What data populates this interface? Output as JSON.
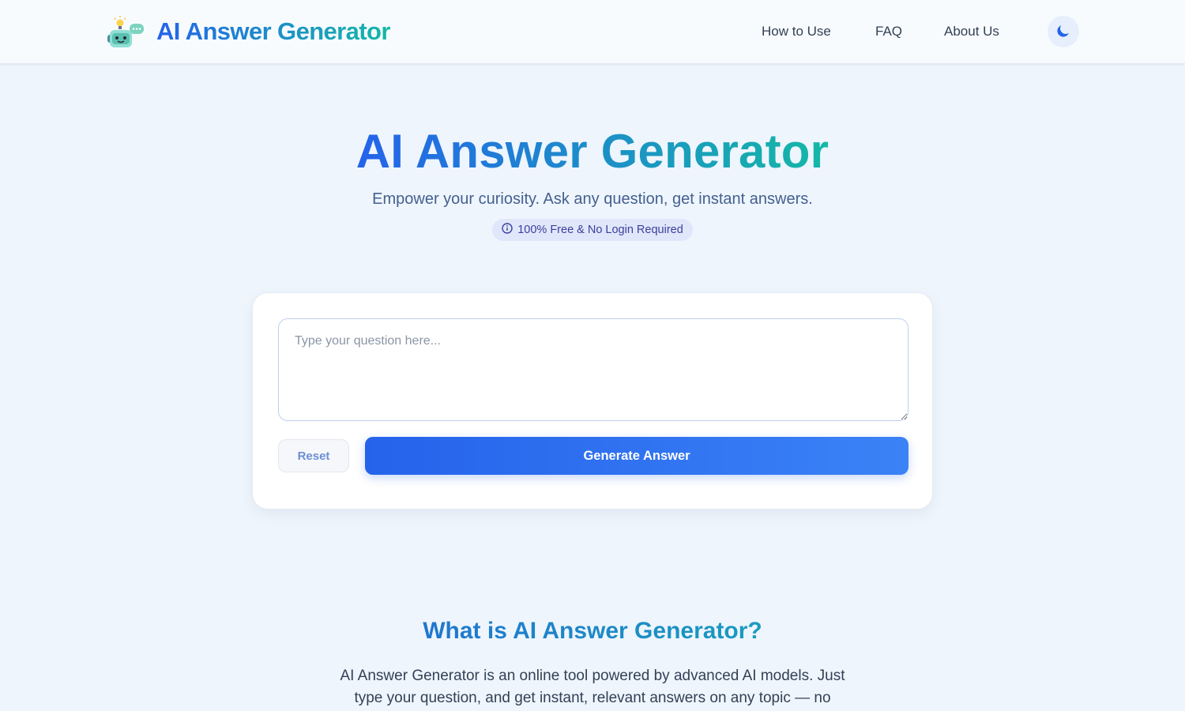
{
  "header": {
    "brand": "AI Answer Generator",
    "nav": {
      "how_to_use": "How to Use",
      "faq": "FAQ",
      "about_us": "About Us"
    },
    "theme_toggle_icon": "moon-icon",
    "logo_icon": "robot-chat-icon"
  },
  "hero": {
    "title": "AI Answer Generator",
    "subtitle": "Empower your curiosity. Ask any question, get instant answers.",
    "badge": {
      "icon": "info-icon",
      "text": "100% Free & No Login Required"
    }
  },
  "form": {
    "question_placeholder": "Type your question here...",
    "question_value": "",
    "reset_label": "Reset",
    "generate_label": "Generate Answer"
  },
  "about": {
    "title": "What is AI Answer Generator?",
    "text": "AI Answer Generator is an online tool powered by advanced AI models. Just type your question, and get instant, relevant answers on any topic — no"
  },
  "colors": {
    "brand_gradient_start": "#2563eb",
    "brand_gradient_end": "#14b8a6",
    "page_background": "#eef5fd",
    "primary_button": "#2563eb",
    "badge_background": "#e0e7fb"
  }
}
